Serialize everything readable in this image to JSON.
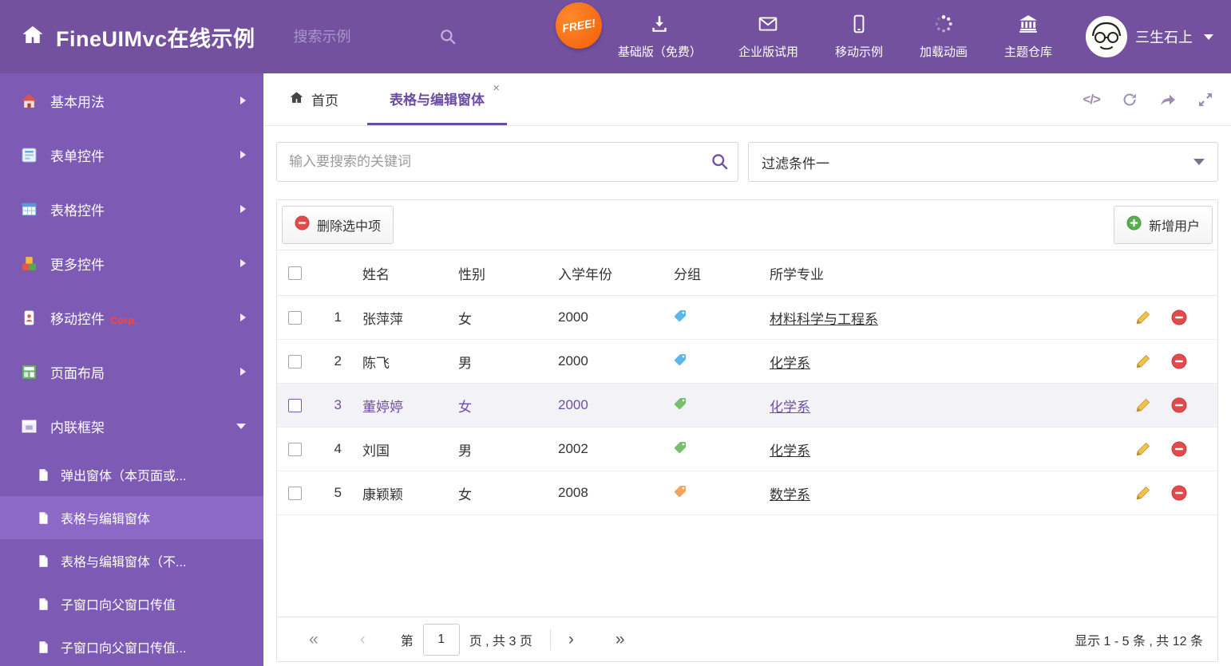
{
  "header": {
    "title": "FineUIMvc在线示例",
    "search_placeholder": "搜索示例",
    "free_badge": "FREE!",
    "nav_items": [
      {
        "label": "基础版（免费）",
        "icon": "download-icon"
      },
      {
        "label": "企业版试用",
        "icon": "envelope-icon"
      },
      {
        "label": "移动示例",
        "icon": "mobile-icon"
      },
      {
        "label": "加载动画",
        "icon": "spinner-icon"
      },
      {
        "label": "主题仓库",
        "icon": "bank-icon"
      }
    ],
    "user_name": "三生石上"
  },
  "sidebar": {
    "items": [
      {
        "label": "基本用法"
      },
      {
        "label": "表单控件"
      },
      {
        "label": "表格控件"
      },
      {
        "label": "更多控件"
      },
      {
        "label": "移动控件",
        "badge": "Corp."
      },
      {
        "label": "页面布局"
      },
      {
        "label": "内联框架",
        "expanded": true
      }
    ],
    "sub_items": [
      {
        "label": "弹出窗体（本页面或..."
      },
      {
        "label": "表格与编辑窗体",
        "selected": true
      },
      {
        "label": "表格与编辑窗体（不..."
      },
      {
        "label": "子窗口向父窗口传值"
      },
      {
        "label": "子窗口向父窗口传值..."
      }
    ]
  },
  "tabs": {
    "home": "首页",
    "active": "表格与编辑窗体",
    "close": "×"
  },
  "tab_tools": {
    "code": "</>"
  },
  "filter": {
    "search_placeholder": "输入要搜索的关键词",
    "dropdown_value": "过滤条件一"
  },
  "toolbar": {
    "delete_label": "删除选中项",
    "add_label": "新增用户"
  },
  "table": {
    "headers": {
      "name": "姓名",
      "gender": "性别",
      "year": "入学年份",
      "group": "分组",
      "major": "所学专业"
    },
    "rows": [
      {
        "index": "1",
        "name": "张萍萍",
        "gender": "女",
        "year": "2000",
        "tag_color": "#5fb6e8",
        "major": "材料科学与工程系",
        "selected": false
      },
      {
        "index": "2",
        "name": "陈飞",
        "gender": "男",
        "year": "2000",
        "tag_color": "#5fb6e8",
        "major": "化学系",
        "selected": false
      },
      {
        "index": "3",
        "name": "董婷婷",
        "gender": "女",
        "year": "2000",
        "tag_color": "#77c06b",
        "major": "化学系",
        "selected": true
      },
      {
        "index": "4",
        "name": "刘国",
        "gender": "男",
        "year": "2002",
        "tag_color": "#77c06b",
        "major": "化学系",
        "selected": false
      },
      {
        "index": "5",
        "name": "康颖颖",
        "gender": "女",
        "year": "2008",
        "tag_color": "#f2a35c",
        "major": "数学系",
        "selected": false
      }
    ]
  },
  "pagination": {
    "first": "«",
    "prev": "‹",
    "page_label_before": "第",
    "current_page": "1",
    "page_label_after": "页 , 共 3 页",
    "next": "›",
    "last": "»",
    "summary": "显示 1 - 5 条 , 共 12 条"
  },
  "colors": {
    "accent": "#6b4ba4",
    "header_bg": "#74519f",
    "sidebar_bg": "#7d5ab3"
  }
}
